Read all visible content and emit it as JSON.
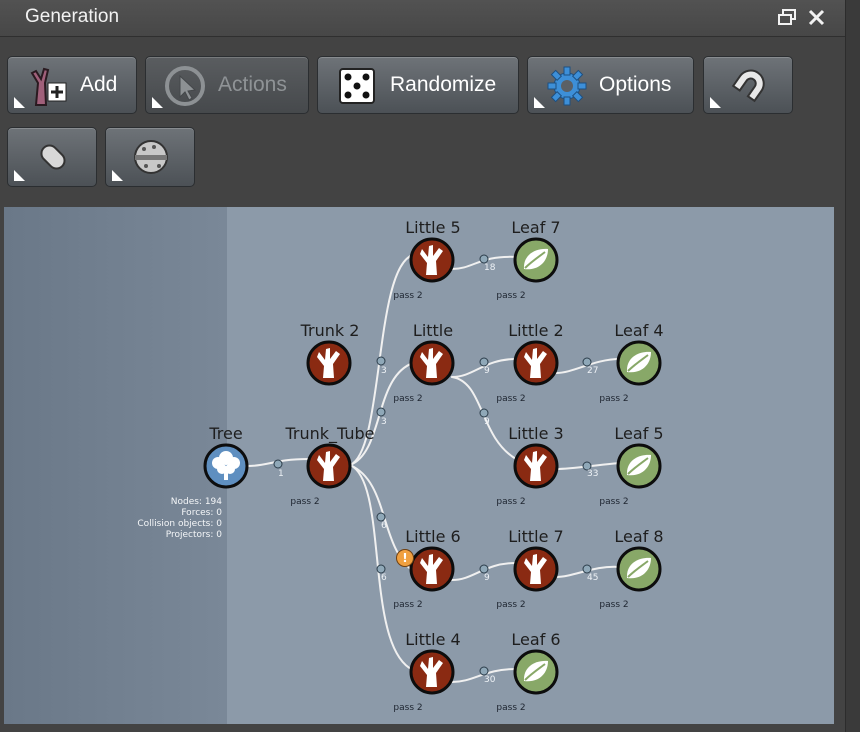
{
  "window": {
    "title": "Generation"
  },
  "toolbar": {
    "add_label": "Add",
    "actions_label": "Actions",
    "randomize_label": "Randomize",
    "options_label": "Options"
  },
  "graph": {
    "tree": {
      "title": "Tree",
      "stats": {
        "nodes": "Nodes: 194",
        "forces": "Forces: 0",
        "collision": "Collision objects: 0",
        "projectors": "Projectors: 0"
      }
    },
    "nodes": {
      "trunk_tube": {
        "title": "Trunk_Tube",
        "pass": "pass 2"
      },
      "trunk_2": {
        "title": "Trunk 2"
      },
      "little_5": {
        "title": "Little 5",
        "pass": "pass 2"
      },
      "leaf_7": {
        "title": "Leaf 7",
        "pass": "pass 2"
      },
      "little": {
        "title": "Little",
        "pass": "pass 2"
      },
      "little_2": {
        "title": "Little 2",
        "pass": "pass 2"
      },
      "leaf_4": {
        "title": "Leaf 4",
        "pass": "pass 2"
      },
      "little_3": {
        "title": "Little 3",
        "pass": "pass 2"
      },
      "leaf_5": {
        "title": "Leaf 5",
        "pass": "pass 2"
      },
      "little_6": {
        "title": "Little 6",
        "pass": "pass 2"
      },
      "little_7": {
        "title": "Little 7",
        "pass": "pass 2"
      },
      "leaf_8": {
        "title": "Leaf 8",
        "pass": "pass 2"
      },
      "little_4": {
        "title": "Little 4",
        "pass": "pass 2"
      },
      "leaf_6": {
        "title": "Leaf 6",
        "pass": "pass 2"
      }
    },
    "ports": {
      "tree_trunk": "1",
      "little5_leaf7": "18",
      "trunk_little5": "3",
      "trunk_little": "3",
      "little_little2": "9",
      "little2_leaf4": "27",
      "little_little3": "9",
      "little3_leaf5": "33",
      "trunk_little6": "6",
      "little6_little7": "9",
      "little7_leaf8": "45",
      "trunk_little4": "6",
      "little4_leaf6": "30"
    }
  },
  "colors": {
    "branch_node": "#8a2a12",
    "leaf_node": "#88a868",
    "tree_node": "#5f8fc0",
    "canvas": "#8c9aa9",
    "panel": "#434343"
  }
}
